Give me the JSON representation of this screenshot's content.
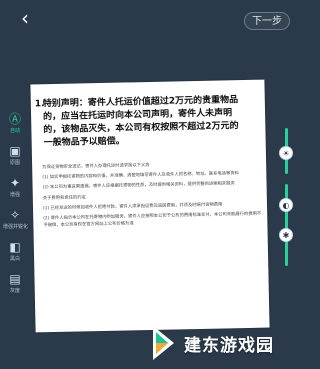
{
  "topbar": {
    "next_label": "下一步"
  },
  "toolbar": {
    "items": [
      {
        "label": "自动",
        "icon": "auto-icon"
      },
      {
        "label": "原图",
        "icon": "image-icon"
      },
      {
        "label": "增强",
        "icon": "enhance-icon"
      },
      {
        "label": "增强并锐化",
        "icon": "sharpen-icon"
      },
      {
        "label": "黑白",
        "icon": "black-white-icon"
      },
      {
        "label": "灰度",
        "icon": "grayscale-icon"
      }
    ]
  },
  "document": {
    "heading_number": "1.",
    "heading_text": "特别声明：寄件人托运价值超过2万元的贵重物品的，应当在托运时向本公司声明，寄件人未声明的，该物品灭失，本公司有权按照不超过2万元的一般物品予以赔偿。",
    "body_paragraphs": [
      "为保证货物安全送达，寄件人办理托运时请求按以下义务",
      "(1) 如实申报托寄物的内容和价值，并准确、清楚地填写寄件人及收件人的名称、地址、联系电话等资料",
      "(2) 本公司为事宜需遗漏，寄件人应根据托寄物的性质，及时提供相关资料，提供完整的运输相关服务",
      "关于费用和责任的约定",
      "(1) 已经发运的时候如收件人拒绝付款，寄件人须承担运费及返回费用，并须及时赔付货物费用",
      "(2) 寄件人指示本公司在托寄物内附加服务，寄件人应按照本公司于公布的费用标准支付，本公司未能履行的费用不予赔偿，本公司有权在官方网站上公布价格为准"
    ]
  },
  "colors": {
    "accent": "#29d19a",
    "background": "#2b3a4a"
  },
  "watermark": {
    "text": "建东游戏园"
  }
}
